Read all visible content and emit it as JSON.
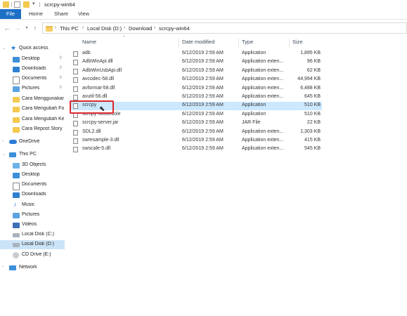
{
  "window": {
    "title": "scrcpy-win64"
  },
  "ribbon": {
    "tabs": [
      "File",
      "Home",
      "Share",
      "View"
    ]
  },
  "address": {
    "crumbs": [
      "This PC",
      "Local Disk (D:)",
      "Download",
      "scrcpy-win64"
    ]
  },
  "sidebar": {
    "items": [
      {
        "label": "Quick access",
        "icon": "star-icon",
        "pinned": false,
        "selected": false
      },
      {
        "label": "Desktop",
        "icon": "desktop-icon",
        "pinned": true,
        "selected": false
      },
      {
        "label": "Downloads",
        "icon": "download-icon",
        "pinned": true,
        "selected": false
      },
      {
        "label": "Documents",
        "icon": "document-icon",
        "pinned": true,
        "selected": false
      },
      {
        "label": "Pictures",
        "icon": "picture-icon",
        "pinned": true,
        "selected": false
      },
      {
        "label": "Cara Menggunakan",
        "icon": "folder-icon",
        "pinned": false,
        "selected": false
      },
      {
        "label": "Cara Mengubah Fot",
        "icon": "folder-icon",
        "pinned": false,
        "selected": false
      },
      {
        "label": "Cara Mengubah Key",
        "icon": "folder-icon",
        "pinned": false,
        "selected": false
      },
      {
        "label": "Cara Repost Story Ir",
        "icon": "folder-icon",
        "pinned": false,
        "selected": false
      },
      {
        "label": "OneDrive",
        "icon": "cloud-icon",
        "pinned": false,
        "selected": false
      },
      {
        "label": "This PC",
        "icon": "computer-icon",
        "pinned": false,
        "selected": false
      },
      {
        "label": "3D Objects",
        "icon": "cube-icon",
        "pinned": false,
        "selected": false
      },
      {
        "label": "Desktop",
        "icon": "desktop-icon",
        "pinned": false,
        "selected": false
      },
      {
        "label": "Documents",
        "icon": "document-icon",
        "pinned": false,
        "selected": false
      },
      {
        "label": "Downloads",
        "icon": "download-icon",
        "pinned": false,
        "selected": false
      },
      {
        "label": "Music",
        "icon": "music-icon",
        "pinned": false,
        "selected": false
      },
      {
        "label": "Pictures",
        "icon": "picture-icon",
        "pinned": false,
        "selected": false
      },
      {
        "label": "Videos",
        "icon": "video-icon",
        "pinned": false,
        "selected": false
      },
      {
        "label": "Local Disk (C:)",
        "icon": "drive-icon",
        "pinned": false,
        "selected": false
      },
      {
        "label": "Local Disk (D:)",
        "icon": "drive-icon",
        "pinned": false,
        "selected": true
      },
      {
        "label": "CD Drive (E:)",
        "icon": "cd-drive-icon",
        "pinned": false,
        "selected": false
      },
      {
        "label": "Network",
        "icon": "network-icon",
        "pinned": false,
        "selected": false
      }
    ]
  },
  "columns": {
    "name": "Name",
    "date": "Date modified",
    "type": "Type",
    "size": "Size"
  },
  "files": [
    {
      "name": "adb",
      "date": "6/12/2019 2:59 AM",
      "type": "Application",
      "size": "1,895 KB"
    },
    {
      "name": "AdbWinApi.dll",
      "date": "6/12/2019 2:59 AM",
      "type": "Application exten...",
      "size": "96 KB"
    },
    {
      "name": "AdbWinUsbApi.dll",
      "date": "6/12/2019 2:59 AM",
      "type": "Application exten...",
      "size": "62 KB"
    },
    {
      "name": "avcodec-58.dll",
      "date": "6/12/2019 2:59 AM",
      "type": "Application exten...",
      "size": "44,994 KB"
    },
    {
      "name": "avformat-58.dll",
      "date": "6/12/2019 2:59 AM",
      "type": "Application exten...",
      "size": "6,488 KB"
    },
    {
      "name": "avutil-56.dll",
      "date": "6/12/2019 2:59 AM",
      "type": "Application exten...",
      "size": "645 KB"
    },
    {
      "name": "scrcpy",
      "date": "6/12/2019 2:59 AM",
      "type": "Application",
      "size": "510 KB"
    },
    {
      "name": "scrcpy-noconsole",
      "date": "6/12/2019 2:59 AM",
      "type": "Application",
      "size": "510 KB"
    },
    {
      "name": "scrcpy-server.jar",
      "date": "6/12/2019 2:59 AM",
      "type": "JAR File",
      "size": "22 KB"
    },
    {
      "name": "SDL2.dll",
      "date": "6/12/2019 2:59 AM",
      "type": "Application exten...",
      "size": "1,303 KB"
    },
    {
      "name": "swresample-3.dll",
      "date": "6/12/2019 2:59 AM",
      "type": "Application exten...",
      "size": "415 KB"
    },
    {
      "name": "swscale-5.dll",
      "date": "6/12/2019 2:59 AM",
      "type": "Application exten...",
      "size": "545 KB"
    }
  ],
  "selected_file": "scrcpy",
  "colors": {
    "file_tab": "#1e70c6",
    "selection": "#cce8ff",
    "highlight_box": "#d8282f"
  }
}
